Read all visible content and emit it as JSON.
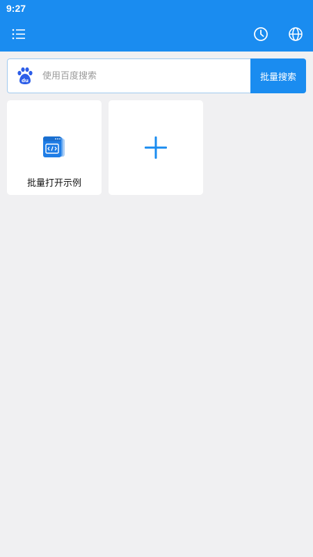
{
  "status_bar": {
    "time": "9:27"
  },
  "toolbar": {
    "menu_icon": "list-menu-icon",
    "history_icon": "clock-icon",
    "globe_icon": "globe-icon",
    "accent_color": "#1a8cf0"
  },
  "search": {
    "engine_icon": "baidu-paw-icon",
    "placeholder": "使用百度搜索",
    "value": "",
    "button_label": "批量搜索"
  },
  "cards": [
    {
      "label": "批量打开示例",
      "icon": "code-window-icon"
    },
    {
      "label": "",
      "icon": "plus-icon"
    }
  ]
}
